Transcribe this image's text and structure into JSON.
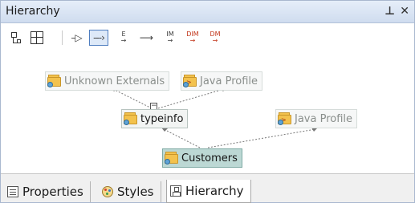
{
  "window": {
    "title": "Hierarchy",
    "pin_glyph": "⊥",
    "close_glyph": "✕"
  },
  "toolbar": {
    "tools": [
      {
        "name": "tree-layout-icon"
      },
      {
        "name": "grid-layout-icon"
      },
      {
        "name": "inheritance-arrow-icon",
        "glyph": "–▷"
      },
      {
        "name": "dashed-arrow-icon",
        "glyph": "---›",
        "selected": true
      },
      {
        "name": "reference-arrow-icon",
        "glyph": "E"
      },
      {
        "name": "plain-arrow-icon",
        "glyph": "⟶"
      },
      {
        "name": "im-arrow-icon",
        "glyph": "IM"
      },
      {
        "name": "red-im-arrow-icon",
        "glyph": "DIM"
      },
      {
        "name": "red-m-arrow-icon",
        "glyph": "DM"
      }
    ]
  },
  "diagram": {
    "nodes": {
      "unknown_externals": "Unknown Externals",
      "java_profile_top": "Java Profile",
      "typeinfo": "typeinfo",
      "java_profile_right": "Java Profile",
      "customers": "Customers"
    },
    "collapse_glyph": "−"
  },
  "tabs": [
    {
      "label": "Properties",
      "icon": "properties-icon"
    },
    {
      "label": "Styles",
      "icon": "styles-icon"
    },
    {
      "label": "Hierarchy",
      "icon": "hierarchy-icon",
      "active": true
    }
  ],
  "colors": {
    "selected_node": "#bcd8d4",
    "accent": "#4f7ec0",
    "titlebar": "#cfdcef"
  }
}
